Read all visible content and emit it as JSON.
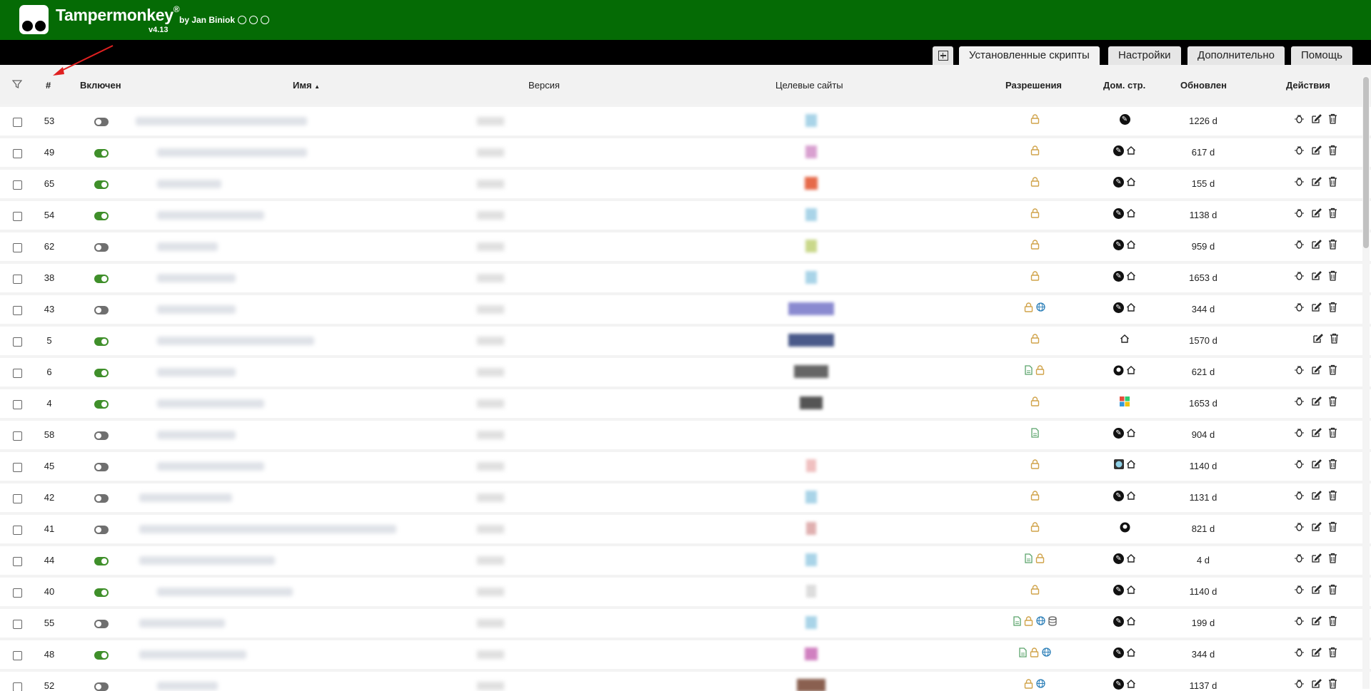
{
  "header": {
    "app_name": "Tampermonkey",
    "registered": "®",
    "byline": "by Jan Biniok",
    "version": "v4.13",
    "bg_color": "#056b05"
  },
  "tabs": [
    {
      "label": "Установленные скрипты",
      "active": true
    },
    {
      "label": "Настройки",
      "active": false
    },
    {
      "label": "Дополнительно",
      "active": false
    },
    {
      "label": "Помощь",
      "active": false
    }
  ],
  "columns": {
    "filter_icon": "filter-icon",
    "num": "#",
    "enabled": "Включен",
    "name": "Имя",
    "sort_indicator": "▲",
    "version": "Версия",
    "sites": "Целевые сайты",
    "perms": "Разрешения",
    "homepage": "Дом. стр.",
    "updated": "Обновлен",
    "actions": "Действия"
  },
  "rows": [
    {
      "num": "53",
      "enabled": false,
      "updated": "1226 d"
    },
    {
      "num": "49",
      "enabled": true,
      "updated": "617 d"
    },
    {
      "num": "65",
      "enabled": true,
      "updated": "155 d"
    },
    {
      "num": "54",
      "enabled": true,
      "updated": "1138 d"
    },
    {
      "num": "62",
      "enabled": false,
      "updated": "959 d"
    },
    {
      "num": "38",
      "enabled": true,
      "updated": "1653 d"
    },
    {
      "num": "43",
      "enabled": false,
      "updated": "344 d"
    },
    {
      "num": "5",
      "enabled": true,
      "updated": "1570 d"
    },
    {
      "num": "6",
      "enabled": true,
      "updated": "621 d"
    },
    {
      "num": "4",
      "enabled": true,
      "updated": "1653 d"
    },
    {
      "num": "58",
      "enabled": false,
      "updated": "904 d"
    },
    {
      "num": "45",
      "enabled": false,
      "updated": "1140 d"
    },
    {
      "num": "42",
      "enabled": false,
      "updated": "1131 d"
    },
    {
      "num": "41",
      "enabled": false,
      "updated": "821 d"
    },
    {
      "num": "44",
      "enabled": true,
      "updated": "4 d"
    },
    {
      "num": "40",
      "enabled": true,
      "updated": "1140 d"
    },
    {
      "num": "55",
      "enabled": false,
      "updated": "199 d"
    },
    {
      "num": "48",
      "enabled": true,
      "updated": "344 d"
    },
    {
      "num": "52",
      "enabled": false,
      "updated": "1137 d"
    }
  ]
}
